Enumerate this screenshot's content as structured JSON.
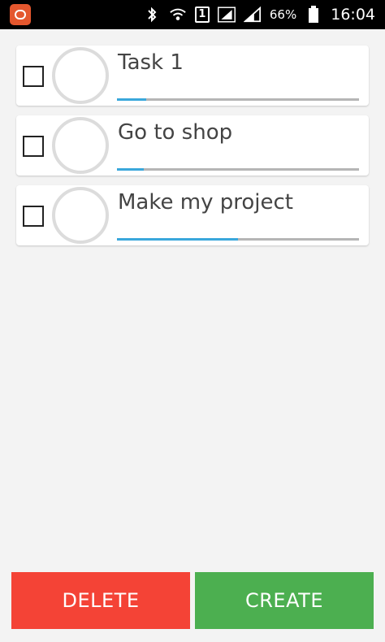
{
  "status_bar": {
    "battery": "66%",
    "time": "16:04",
    "sim_label": "1"
  },
  "tasks": [
    {
      "title": "Task 1",
      "progress": 0.12
    },
    {
      "title": "Go to shop",
      "progress": 0.11
    },
    {
      "title": "Make my project",
      "progress": 0.5
    }
  ],
  "buttons": {
    "delete_label": "DELETE",
    "create_label": "CREATE"
  },
  "colors": {
    "delete": "#f44336",
    "create": "#4caf50",
    "progress": "#3aa7db",
    "track": "#b5b5b5"
  }
}
